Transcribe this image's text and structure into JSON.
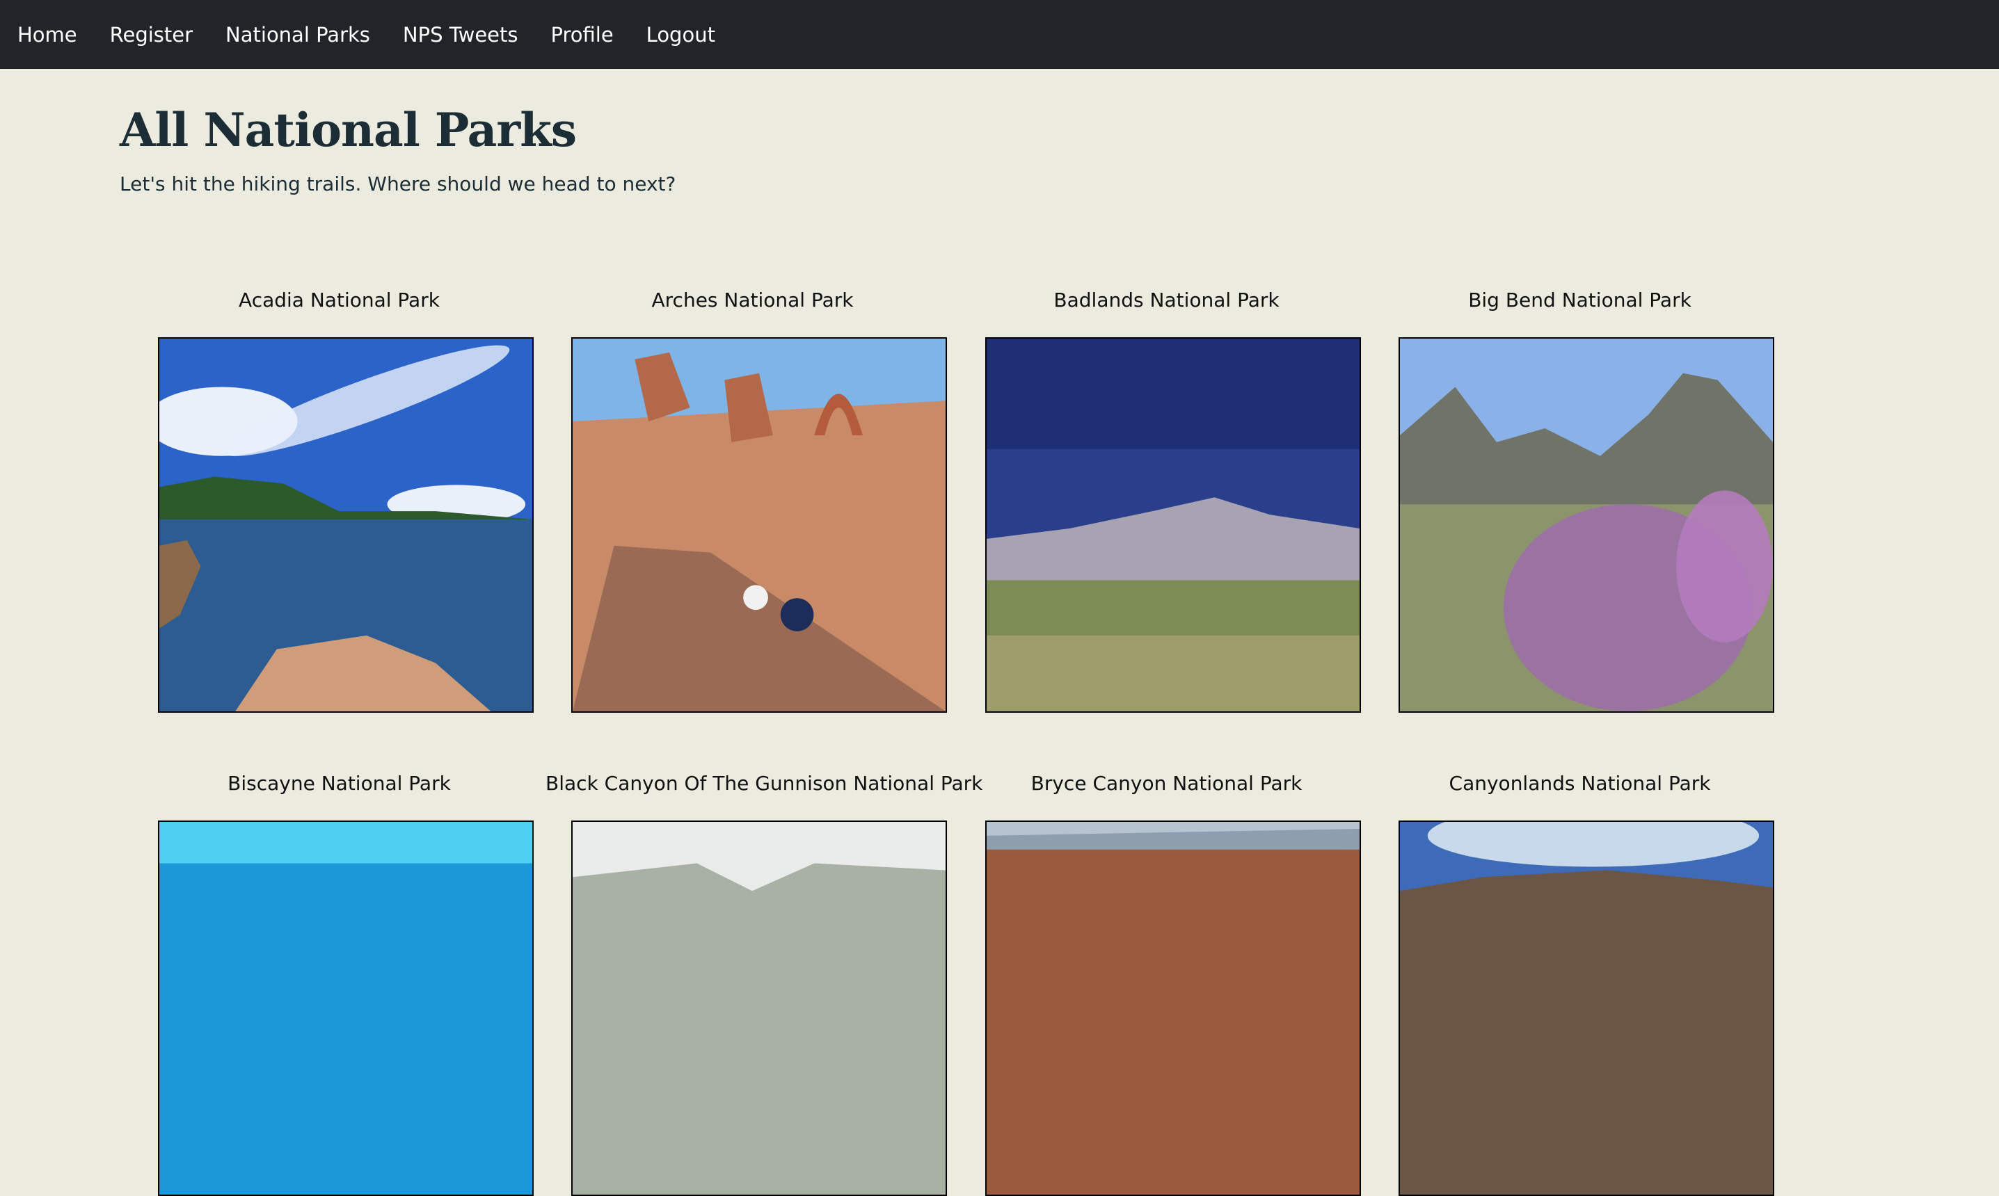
{
  "nav": {
    "items": [
      {
        "label": "Home"
      },
      {
        "label": "Register"
      },
      {
        "label": "National Parks"
      },
      {
        "label": "NPS Tweets"
      },
      {
        "label": "Profile"
      },
      {
        "label": "Logout"
      }
    ]
  },
  "header": {
    "title": "All National Parks",
    "subtitle": "Let's hit the hiking trails. Where should we head to next?"
  },
  "parks": [
    {
      "name": "Acadia National Park"
    },
    {
      "name": "Arches National Park"
    },
    {
      "name": "Badlands National Park"
    },
    {
      "name": "Big Bend National Park"
    },
    {
      "name": "Biscayne National Park"
    },
    {
      "name": "Black Canyon Of The Gunnison National Park"
    },
    {
      "name": "Bryce Canyon National Park"
    },
    {
      "name": "Canyonlands National Park"
    }
  ],
  "colors": {
    "navbar": "#212529",
    "page_background": "#ecebe0",
    "title": "#1d2d35"
  }
}
